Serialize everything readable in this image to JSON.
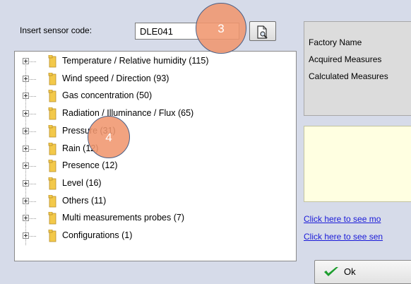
{
  "sensor_search": {
    "label": "Insert sensor code:",
    "value": "DLE041",
    "button_icon": "document-search-icon"
  },
  "tree": {
    "items": [
      {
        "label": "Temperature / Relative humidity (115)"
      },
      {
        "label": "Wind speed  / Direction (93)"
      },
      {
        "label": "Gas concentration (50)"
      },
      {
        "label": "Radiation / Illuminance / Flux (65)"
      },
      {
        "label": "Pressure (31)"
      },
      {
        "label": "Rain (12)"
      },
      {
        "label": "Presence (12)"
      },
      {
        "label": "Level (16)"
      },
      {
        "label": "Others (11)"
      },
      {
        "label": "Multi measurements probes (7)"
      },
      {
        "label": "Configurations (1)"
      }
    ],
    "icons": {
      "expander": "plus-box-icon",
      "folder": "folder-icon"
    }
  },
  "info_panel": {
    "rows": [
      "Factory Name",
      "Acquired Measures",
      "Calculated Measures"
    ]
  },
  "links": [
    "Click here to see mo",
    "Click here to see sen"
  ],
  "ok_button": {
    "label": "Ok",
    "icon": "green-check-icon"
  },
  "annotations": [
    "3",
    "4"
  ],
  "colors": {
    "window_bg": "#d6dbe9",
    "note_bg": "#ffffe1",
    "link": "#1a1ad8",
    "annotation_fill": "#f0966e",
    "annotation_border": "#4a5f86"
  }
}
